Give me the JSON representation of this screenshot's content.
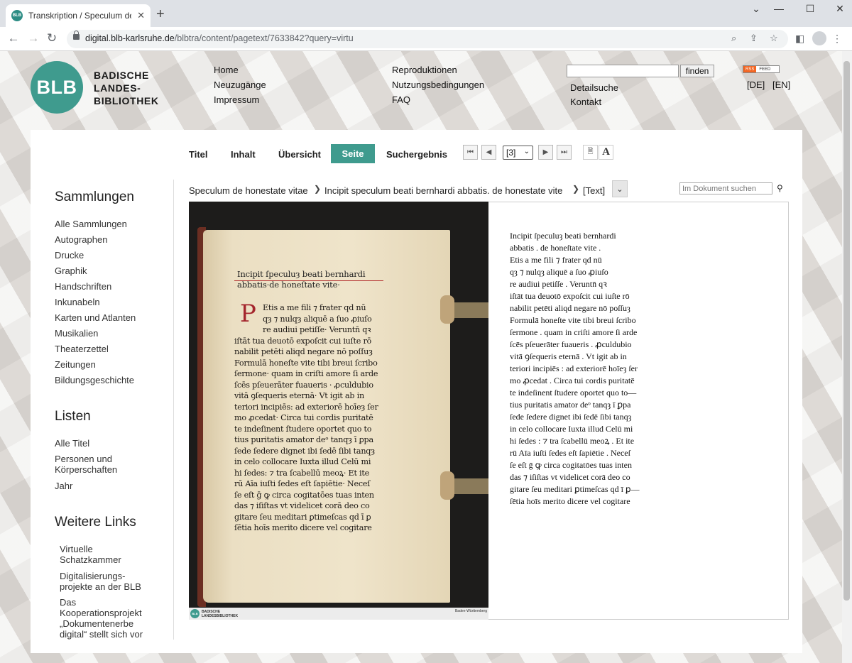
{
  "browser": {
    "tab_title": "Transkription / Speculum de hon",
    "tab_favicon": "BLB",
    "url_host": "digital.blb-karlsruhe.de",
    "url_path": "/blbtra/content/pagetext/7633842?query=virtu"
  },
  "header": {
    "logo_circle": "BLB",
    "logo_lines": [
      "BADISCHE",
      "LANDES-",
      "BIBLIOTHEK"
    ],
    "nav_col1": [
      "Home",
      "Neuzugänge",
      "Impressum"
    ],
    "nav_col2": [
      "Reproduktionen",
      "Nutzungsbedingungen",
      "FAQ"
    ],
    "nav_col3": [
      "Detailsuche",
      "Kontakt"
    ],
    "search_button": "finden",
    "rss_label": "RSS",
    "rss_feed": "FEED",
    "lang_de": "[DE]",
    "lang_en": "[EN]"
  },
  "toolbar": {
    "tabs": [
      "Titel",
      "Inhalt",
      "Übersicht",
      "Seite",
      "Suchergebnis"
    ],
    "page_select": "[3]"
  },
  "sidebar": {
    "sammlungen_heading": "Sammlungen",
    "sammlungen": [
      "Alle Sammlungen",
      "Autographen",
      "Drucke",
      "Graphik",
      "Handschriften",
      "Inkunabeln",
      "Karten und Atlanten",
      "Musikalien",
      "Theaterzettel",
      "Zeitungen",
      "Bildungsgeschichte"
    ],
    "listen_heading": "Listen",
    "listen": [
      "Alle Titel",
      "Personen und Körperschaften",
      "Jahr"
    ],
    "links_heading": "Weitere Links",
    "links": [
      "Virtuelle Schatzkammer",
      "Digitalisierungs-projekte an der BLB",
      "Das Kooperationsprojekt „Dokumentenerbe digital“ stellt sich vor"
    ]
  },
  "breadcrumb": {
    "item1": "Speculum de honestate vitae",
    "item2": "Incipit speculum beati bernhardi abbatis. de honestate vite",
    "item3": "[Text]",
    "search_placeholder": "Im Dokument suchen"
  },
  "scan": {
    "footer_logo": "BLB",
    "footer_lines": [
      "BADISCHE",
      "LANDESBIBLIOTHEK"
    ],
    "footer_right": "Baden-Württemberg",
    "title_lines": [
      "Incipit ſpeculuȝ beati bernhardi",
      "abbatis·de honeſtate vite·"
    ],
    "initial": "P",
    "body_lines": [
      "Etis a me fili ⁊ frater qd nū",
      "qȝ ⁊ nulqȝ aliquē a ſuo ꝓiuſo",
      "re audiui petiſſe· Veruntn̄ qꝛ",
      "iſtāt tua deuotō expoſcit cui iuſte rō",
      "nabilit petēti aliqd negare nō poſſuȝ",
      "Formulā honeſte vite tibi breui ſcribo",
      "ſermone· quam in criſti amore ſi arde",
      "ſcēs pſeuerāter fuaueris · ꝓculdubio",
      "vitā ꝯſequeris eternā· Vt igit ab in",
      "teriori incipiēs: ad exteriorē hoīeȝ ſer",
      "mo ꝓcedat· Circa tui cordis puritatē",
      "te indeſinent ſtudere oportet quo to",
      "tius puritatis amator deᵒ tanqȝ ī ꝑpa",
      "ſede ſedere dignet ibi ſedē ſibi tanqȝ",
      "in celo collocare Iuxta illud Celū mi",
      "hi ſedes: ⁊ tra ſcabellū meoꝝ· Et ite",
      "rū Aīa iuſti ſedes eſt ſapiētie· Neceſ",
      "ſe eſt ḡ ꝙ circa cogitatōes tuas inten",
      "das ⁊ iſiſtas vt videlicet corā deo co",
      "gitare ſeu meditari ꝑtimeſcas qd ī ꝑ",
      "ſētia hoīs merito dicere vel cogitare"
    ]
  },
  "transcription": [
    "Incipit ſpeculuȝ beati bernhardi",
    "abbatis . de honeſtate vite .",
    "Etis a me fili ⁊ frater qd nū",
    "qȝ ⁊ nulqȝ aliquē a ſuo ꝓiuſo",
    "re audiui petiſſe . Veruntn̄ qꝛ",
    "iſtāt tua deuotō expoſcit cui iuſte rō",
    "nabilit petēti aliqd negare nō poſſuȝ",
    "Formulā honeſte vite tibi breui ſcribo",
    "ſermone . quam in criſti amore ſi arde",
    "ſcēs pſeuerāter fuaueris . ꝓculdubio",
    "vitā ꝯſequeris eternā . Vt igit ab in",
    "teriori incipiēs : ad exteriorē hoīeȝ ſer",
    "mo ꝓcedat . Circa tui cordis puritatē",
    "te indeſinent ſtudere oportet quo to—",
    "tius puritatis amator deᵒ tanqȝ ī ꝑpa",
    "ſede ſedere dignet ibi ſedē ſibi tanqȝ",
    "in celo collocare Iuxta illud Celū mi",
    "hi ſedes : ⁊ tra ſcabellū meoꝝ . Et ite",
    "rū Aīa iuſti ſedes eſt ſapiētie . Neceſ",
    "ſe eſt ḡ ꝙ circa cogitatōes tuas inten",
    "das ⁊ iſiſtas vt videlicet corā deo co",
    "gitare ſeu meditari ꝑtimeſcas qd ī ꝑ—",
    "ſētia hoīs merito dicere vel cogitare"
  ],
  "colors": {
    "accent": "#3f9b8e",
    "rubric": "#a4252c"
  }
}
